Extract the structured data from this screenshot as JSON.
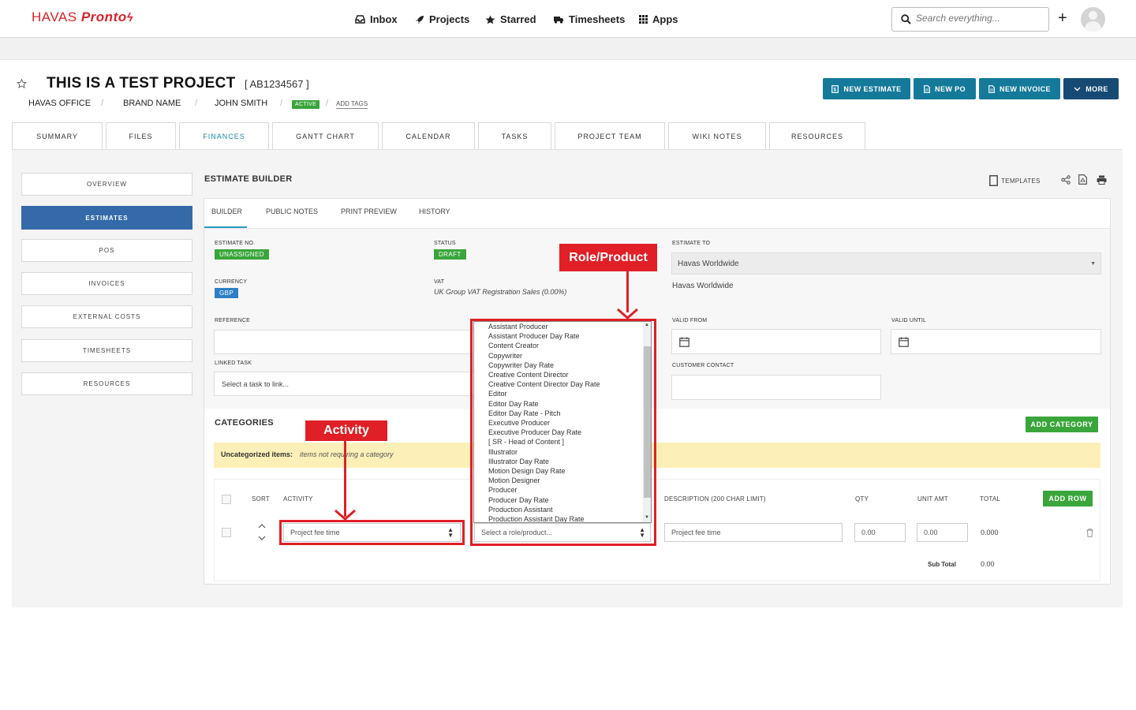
{
  "brand": {
    "name_regular": "HAVAS",
    "name_italic": "Pronto"
  },
  "nav": [
    {
      "label": "Inbox",
      "icon": "inbox-icon"
    },
    {
      "label": "Projects",
      "icon": "rocket-icon"
    },
    {
      "label": "Starred",
      "icon": "star-icon"
    },
    {
      "label": "Timesheets",
      "icon": "truck-icon"
    },
    {
      "label": "Apps",
      "icon": "grid-icon"
    }
  ],
  "search": {
    "placeholder": "Search everything..."
  },
  "project": {
    "title": "THIS IS A TEST PROJECT",
    "code": "[ AB1234567 ]",
    "office": "HAVAS OFFICE",
    "brand": "BRAND NAME",
    "owner": "JOHN SMITH",
    "status_badge": "ACTIVE",
    "add_tags": "ADD TAGS",
    "separator": "/"
  },
  "actions": {
    "new_estimate": "NEW ESTIMATE",
    "new_po": "NEW PO",
    "new_invoice": "NEW INVOICE",
    "more": "MORE"
  },
  "tabs": [
    "SUMMARY",
    "FILES",
    "FINANCES",
    "GANTT CHART",
    "CALENDAR",
    "TASKS",
    "PROJECT TEAM",
    "WIKI NOTES",
    "RESOURCES"
  ],
  "active_tab": "FINANCES",
  "sidenav": [
    "OVERVIEW",
    "ESTIMATES",
    "POS",
    "INVOICES",
    "EXTERNAL COSTS",
    "TIMESHEETS",
    "RESOURCES"
  ],
  "estimate": {
    "section_title": "ESTIMATE BUILDER",
    "templates_label": "TEMPLATES",
    "subtabs": [
      "BUILDER",
      "PUBLIC NOTES",
      "PRINT PREVIEW",
      "HISTORY"
    ],
    "estimate_no_label": "ESTIMATE NO.",
    "estimate_no_value": "UNASSIGNED",
    "status_label": "STATUS",
    "status_value": "DRAFT",
    "estimate_to_label": "ESTIMATE TO",
    "estimate_to_value": "Havas Worldwide",
    "estimate_to_text": "Havas Worldwide",
    "currency_label": "CURRENCY",
    "currency_value": "GBP",
    "vat_label": "VAT",
    "vat_value": "UK Group VAT Registration Sales (0.00%)",
    "reference_label": "REFERENCE",
    "valid_from_label": "VALID FROM",
    "valid_until_label": "VALID UNTIL",
    "linked_task_label": "LINKED TASK",
    "linked_task_placeholder": "Select a task to link...",
    "customer_contact_label": "CUSTOMER CONTACT"
  },
  "categories": {
    "title": "CATEGORIES",
    "add_category": "ADD CATEGORY",
    "uncategorized_bold": "Uncategorized items:",
    "uncategorized_italic": "items not requiring a category"
  },
  "table": {
    "headers": {
      "sort": "SORT",
      "activity": "ACTIVITY",
      "description": "DESCRIPTION (200 CHAR LIMIT)",
      "qty": "QTY",
      "unit_amt": "UNIT AMT",
      "total": "TOTAL"
    },
    "add_row": "ADD ROW",
    "row": {
      "activity": "Project fee time",
      "role_placeholder": "Select a role/product...",
      "description": "Project fee time",
      "qty": "0.00",
      "unit_amt": "0.00",
      "total": "0.000"
    },
    "subtotal_label": "Sub Total",
    "subtotal_value": "0.00"
  },
  "role_options": [
    "Assistant Producer",
    "Assistant Producer Day Rate",
    "Content Creator",
    "Copywriter",
    "Copywriter Day Rate",
    "Creative Content Director",
    "Creative Content Director Day Rate",
    "Editor",
    "Editor Day Rate",
    "Editor Day Rate - Pitch",
    "Executive Producer",
    "Executive Producer Day Rate",
    "[ SR - Head of Content ]",
    "Illustrator",
    "Illustrator Day Rate",
    "Motion Design Day Rate",
    "Motion Designer",
    "Producer",
    "Producer Day Rate",
    "Production Assistant",
    "Production Assistant Day Rate"
  ],
  "annotations": {
    "role_product": "Role/Product",
    "activity": "Activity"
  },
  "colors": {
    "brand_red": "#d8232a",
    "teal": "#157a9a",
    "navy": "#164a73",
    "green": "#3aa53a",
    "annotation_red": "#e01f26",
    "estimates_blue": "#356aa8"
  }
}
